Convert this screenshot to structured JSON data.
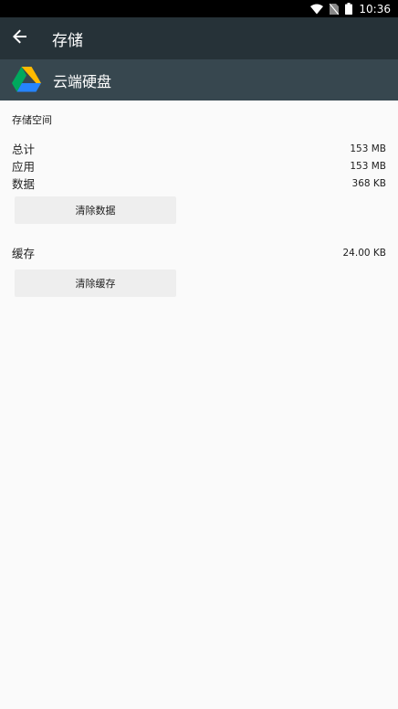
{
  "status_bar": {
    "time": "10:36"
  },
  "toolbar": {
    "title": "存储"
  },
  "app": {
    "name": "云端硬盘"
  },
  "storage": {
    "section_title": "存储空间",
    "rows": [
      {
        "label": "总计",
        "value": "153 MB"
      },
      {
        "label": "应用",
        "value": "153 MB"
      },
      {
        "label": "数据",
        "value": "368 KB"
      }
    ],
    "clear_data_label": "清除数据"
  },
  "cache": {
    "label": "缓存",
    "value": "24.00 KB",
    "clear_cache_label": "清除缓存"
  },
  "icons": {
    "status": [
      "wifi-icon",
      "no-sim-icon",
      "battery-icon"
    ],
    "toolbar": "back-arrow-icon",
    "app": "google-drive-icon"
  }
}
